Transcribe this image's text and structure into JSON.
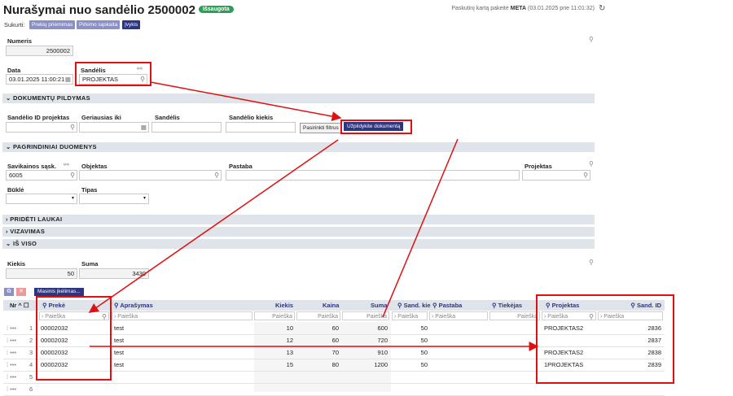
{
  "header": {
    "title": "Nurašymai nuo sandėlio 2500002",
    "status_badge": "Išsaugota",
    "last_changed_label": "Paskutinį kartą pakeitė",
    "last_changed_user": "META",
    "last_changed_time": "(03.01.2025 prie 11:01:32)"
  },
  "create": {
    "label": "Sukurti:",
    "buttons": [
      "Prekių priėmimas",
      "Pirkimo sąskaita",
      "Įvykis"
    ]
  },
  "fields": {
    "numeris_label": "Numeris",
    "numeris_value": "2500002",
    "data_label": "Data",
    "data_value": "03.01.2025 11:00:21",
    "sandelis_label": "Sandėlis",
    "sandelis_value": "PROJEKTAS"
  },
  "sections": {
    "dokumentu": "DOKUMENTŲ PILDYMAS",
    "pagrindiniai": "PAGRINDINIAI DUOMENYS",
    "prideti": "PRIDĖTI LAUKAI",
    "vizavimas": "VIZAVIMAS",
    "is_viso": "IŠ VISO"
  },
  "doc_fill": {
    "sandelio_id_label": "Sandėlio ID projektas",
    "geriausias_label": "Geriausias iki",
    "sandelis_label": "Sandėlis",
    "kiekis_label": "Sandėlio kiekis",
    "filter_button": "Pasirinkti filtrus",
    "fill_button": "Užpildykite dokumentą"
  },
  "main_data": {
    "savikainos_label": "Savikainos sąsk.",
    "savikainos_value": "6005",
    "objektas_label": "Objektas",
    "pastaba_label": "Pastaba",
    "projektas_label": "Projektas",
    "bukle_label": "Būklė",
    "tipas_label": "Tipas"
  },
  "totals": {
    "kiekis_label": "Kiekis",
    "kiekis_value": "50",
    "suma_label": "Suma",
    "suma_value": "3430"
  },
  "grid": {
    "mass_button": "Masinis įkėlimas...",
    "columns": {
      "nr": "Nr",
      "preke": "Prekė",
      "aprasymas": "Aprašymas",
      "kiekis": "Kiekis",
      "kaina": "Kaina",
      "suma": "Suma",
      "sand_kiekis": "Sand. kie",
      "pastaba": "Pastaba",
      "tiekejas": "Tiekėjas",
      "projektas": "Projektas",
      "sand_id": "Sand. ID"
    },
    "search_placeholder": "Paieška",
    "rows": [
      {
        "nr": "1",
        "preke": "00002032",
        "aprasymas": "test",
        "kiekis": "10",
        "kaina": "60",
        "suma": "600",
        "sand": "50",
        "projektas": "PROJEKTAS2",
        "sand_id": "2836"
      },
      {
        "nr": "2",
        "preke": "00002032",
        "aprasymas": "test",
        "kiekis": "12",
        "kaina": "60",
        "suma": "720",
        "sand": "50",
        "projektas": "",
        "sand_id": "2837"
      },
      {
        "nr": "3",
        "preke": "00002032",
        "aprasymas": "test",
        "kiekis": "13",
        "kaina": "70",
        "suma": "910",
        "sand": "50",
        "projektas": "PROJEKTAS2",
        "sand_id": "2838"
      },
      {
        "nr": "4",
        "preke": "00002032",
        "aprasymas": "test",
        "kiekis": "15",
        "kaina": "80",
        "suma": "1200",
        "sand": "50",
        "projektas": "1PROJEKTAS",
        "sand_id": "2839"
      },
      {
        "nr": "5",
        "preke": "",
        "aprasymas": "",
        "kiekis": "",
        "kaina": "",
        "suma": "",
        "sand": "",
        "projektas": "",
        "sand_id": ""
      },
      {
        "nr": "6",
        "preke": "",
        "aprasymas": "",
        "kiekis": "",
        "kaina": "",
        "suma": "",
        "sand": "",
        "projektas": "",
        "sand_id": ""
      }
    ]
  },
  "colors": {
    "accent": "#2b3580",
    "badge": "#2e9d58",
    "annotation": "#e01010"
  }
}
